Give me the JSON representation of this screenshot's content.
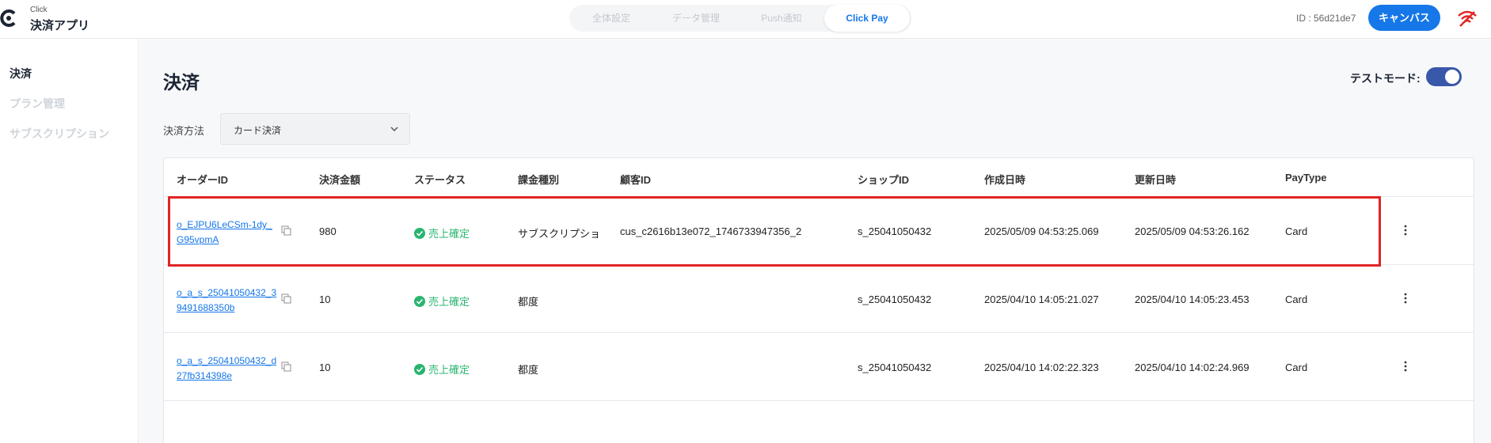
{
  "header": {
    "brand_small": "Click",
    "brand_title": "決済アプリ",
    "tabs": [
      {
        "label": "全体設定"
      },
      {
        "label": "データ管理"
      },
      {
        "label": "Push通知"
      },
      {
        "label": "Click Pay"
      }
    ],
    "active_tab": "Click Pay",
    "id_label": "ID : 56d21de7",
    "canvas_button": "キャンバス"
  },
  "sidebar": {
    "items": [
      {
        "label": "決済"
      },
      {
        "label": "プラン管理"
      },
      {
        "label": "サブスクリプション"
      }
    ]
  },
  "main": {
    "title": "決済",
    "test_mode_label": "テストモード:",
    "test_mode_on": true,
    "method_label": "決済方法",
    "method_value": "カード決済"
  },
  "table": {
    "headers": [
      "オーダーID",
      "決済金額",
      "ステータス",
      "課金種別",
      "顧客ID",
      "ショップID",
      "作成日時",
      "更新日時",
      "PayType"
    ],
    "rows": [
      {
        "order_id": "o_EJPU6LeCSm-1dy_G95vpmA",
        "amount": "980",
        "status": "売上確定",
        "billing_type": "サブスクリプショ",
        "customer_id": "cus_c2616b13e072_1746733947356_2",
        "shop_id": "s_25041050432",
        "created_at": "2025/05/09 04:53:25.069",
        "updated_at": "2025/05/09 04:53:26.162",
        "pay_type": "Card"
      },
      {
        "order_id": "o_a_s_25041050432_39491688350b",
        "amount": "10",
        "status": "売上確定",
        "billing_type": "都度",
        "customer_id": "",
        "shop_id": "s_25041050432",
        "created_at": "2025/04/10 14:05:21.027",
        "updated_at": "2025/04/10 14:05:23.453",
        "pay_type": "Card"
      },
      {
        "order_id": "o_a_s_25041050432_d27fb314398e",
        "amount": "10",
        "status": "売上確定",
        "billing_type": "都度",
        "customer_id": "",
        "shop_id": "s_25041050432",
        "created_at": "2025/04/10 14:02:22.323",
        "updated_at": "2025/04/10 14:02:24.969",
        "pay_type": "Card"
      }
    ]
  },
  "colors": {
    "accent": "#1577e8",
    "status_success": "#2ab56f",
    "highlight": "#e02424",
    "toggle": "#3a58a9"
  }
}
